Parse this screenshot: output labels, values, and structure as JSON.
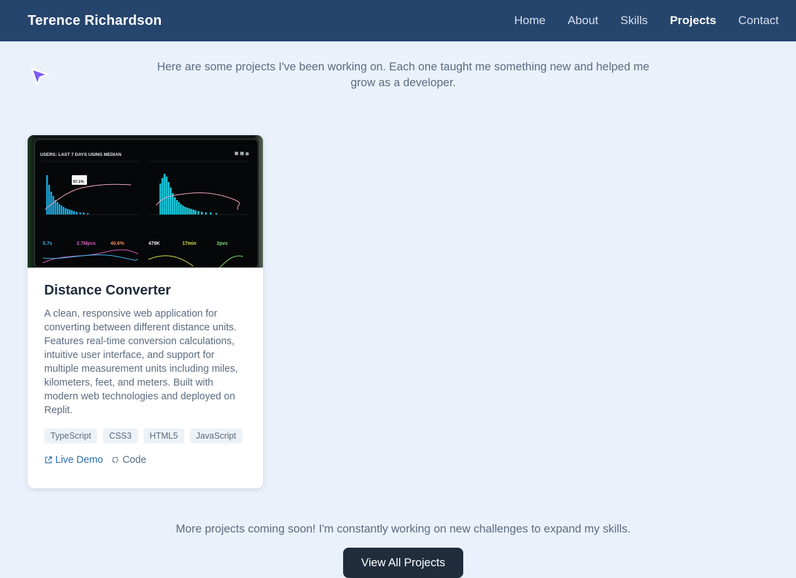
{
  "nav": {
    "brand": "Terence Richardson",
    "links": [
      "Home",
      "About",
      "Skills",
      "Projects",
      "Contact"
    ],
    "active": "Projects"
  },
  "intro": "Here are some projects I've been working on. Each one taught me something new and helped me grow as a developer.",
  "project": {
    "title": "Distance Converter",
    "description": "A clean, responsive web application for converting between different distance units. Features real-time conversion calculations, intuitive user interface, and support for multiple measurement units including miles, kilometers, feet, and meters. Built with modern web technologies and deployed on Replit.",
    "tags": [
      "TypeScript",
      "CSS3",
      "HTML5",
      "JavaScript"
    ],
    "links": {
      "demo": "Live Demo",
      "code": "Code"
    },
    "image": {
      "header": "USERS: LAST 7 DAYS USING MEDIAN",
      "tooltip": "57.1%",
      "stats": [
        "0.7s",
        "2.7Mpvs",
        "40.6%",
        "479K",
        "17min",
        "2pvs"
      ]
    }
  },
  "footer": {
    "text": "More projects coming soon! I'm constantly working on new challenges to expand my skills.",
    "button": "View All Projects"
  },
  "colors": {
    "navbar": "#25456d",
    "page_bg": "#eaf1fa",
    "accent_link": "#2b6cb0",
    "button_bg": "#1f2d3d",
    "cursor": "#7c5cf5"
  },
  "icons": {
    "cursor": "cursor-arrow-icon",
    "demo": "external-link-icon",
    "code": "github-icon"
  }
}
